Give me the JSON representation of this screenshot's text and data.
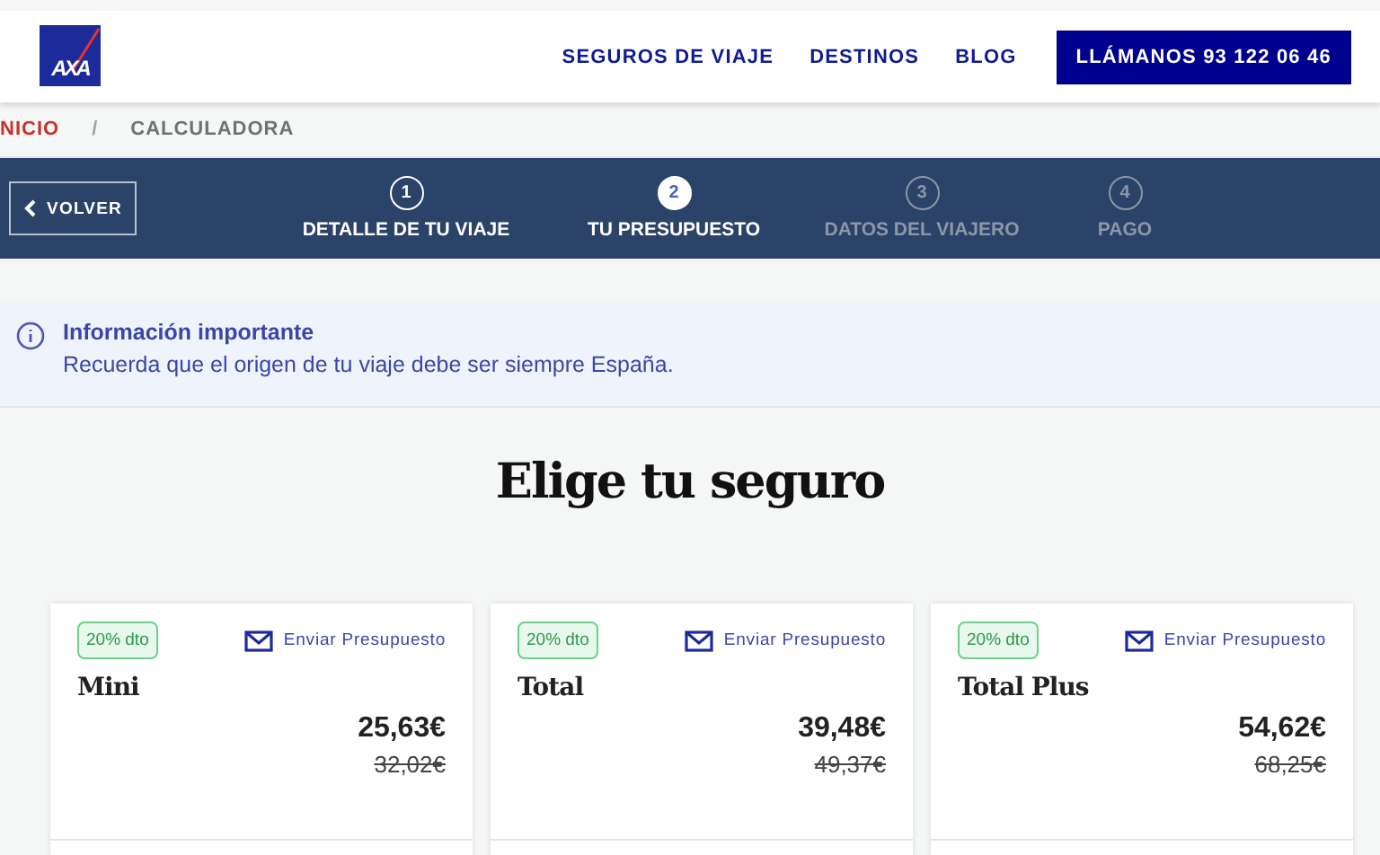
{
  "header": {
    "logo": "AXA",
    "nav": [
      "SEGUROS DE VIAJE",
      "DESTINOS",
      "BLOG"
    ],
    "call_button": "LLÁMANOS 93 122 06 46"
  },
  "breadcrumb": [
    {
      "label": "NICIO",
      "kind": "link"
    },
    {
      "label": "/",
      "kind": "separator"
    },
    {
      "label": "CALCULADORA",
      "kind": "current"
    }
  ],
  "stepper": {
    "back_button": "VOLVER",
    "steps": [
      {
        "number": "1",
        "label": "DETALLE DE TU VIAJE",
        "kind": "done"
      },
      {
        "number": "2",
        "label": "TU PRESUPUESTO",
        "kind": "current"
      },
      {
        "number": "3",
        "label": "DATOS DEL VIAJERO",
        "kind": "upcoming"
      },
      {
        "number": "4",
        "label": "PAGO",
        "kind": "upcoming"
      }
    ]
  },
  "info": {
    "title": "Información importante",
    "text": "Recuerda que el origen de tu viaje debe ser siempre España."
  },
  "heading": "Elige tu seguro",
  "plans": [
    {
      "discount": "20% dto",
      "send": "Enviar Presupuesto",
      "name": "Mini",
      "price": "25,63€",
      "old_price": "32,02€"
    },
    {
      "discount": "20% dto",
      "send": "Enviar Presupuesto",
      "name": "Total",
      "price": "39,48€",
      "old_price": "49,37€"
    },
    {
      "discount": "20% dto",
      "send": "Enviar Presupuesto",
      "name": "Total Plus",
      "price": "54,62€",
      "old_price": "68,25€"
    }
  ]
}
